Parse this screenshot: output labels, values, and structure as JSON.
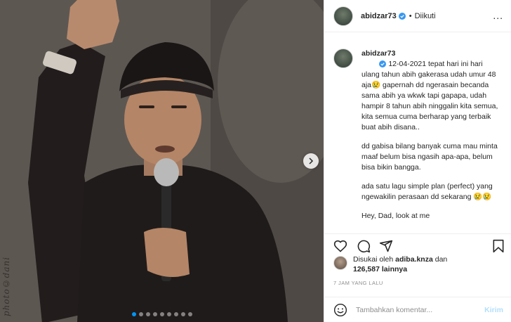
{
  "post": {
    "image_alt": "",
    "watermark": "photo©dani",
    "carousel_count": 9,
    "carousel_active": 1
  },
  "header": {
    "username": "abidzar73",
    "separator": "•",
    "follow_state": "Diikuti",
    "more": "..."
  },
  "caption": {
    "username": "abidzar73",
    "paragraphs": [
      "12-04-2021 tepat hari ini hari ulang tahun abih gakerasa udah umur 48 aja😢 gapernah dd ngerasain becanda sama abih ya wkwk tapi gapapa, udah hampir 8 tahun abih ninggalin kita semua, kita semua cuma berharap yang terbaik buat abih disana..",
      "dd gabisa bilang banyak cuma mau minta maaf belum bisa ngasih apa-apa, belum bisa bikin bangga.",
      "ada satu lagu simple plan (perfect) yang ngewakilin perasaan dd sekarang 😢😢",
      "Hey, Dad, look at me"
    ]
  },
  "likes": {
    "prefix": "Disukai oleh",
    "liker": "adiba.knza",
    "conjunction": "dan",
    "count": "126,587",
    "suffix": "lainnya"
  },
  "timestamp": "7 JAM YANG LALU",
  "comment": {
    "placeholder": "Tambahkan komentar...",
    "post_label": "Kirim"
  },
  "colors": {
    "accent": "#0095f6",
    "post_disabled": "#b2dffc",
    "muted": "#8e8e8e"
  }
}
